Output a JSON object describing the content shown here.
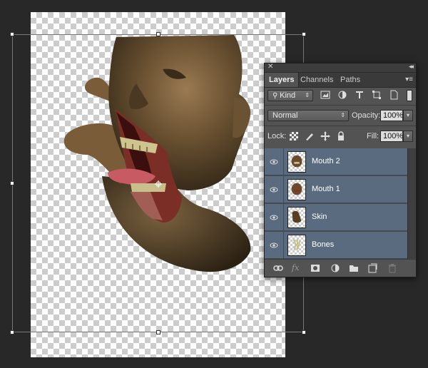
{
  "tabs": [
    "Layers",
    "Channels",
    "Paths"
  ],
  "filter": {
    "label": "Kind"
  },
  "blend": {
    "mode": "Normal",
    "opacity_label": "Opacity:",
    "opacity_value": "100%"
  },
  "lock": {
    "label": "Lock:",
    "fill_label": "Fill:",
    "fill_value": "100%"
  },
  "layers": [
    {
      "name": "Mouth 2"
    },
    {
      "name": "Mouth 1"
    },
    {
      "name": "Skin"
    },
    {
      "name": "Bones"
    }
  ],
  "bottom_icons": [
    "link-icon",
    "fx-icon",
    "mask-icon",
    "adjustment-icon",
    "group-folder-icon",
    "new-layer-icon",
    "trash-icon"
  ],
  "colors": {
    "selected_layer": "#5a6b80",
    "panel": "#535353",
    "background": "#282828"
  }
}
